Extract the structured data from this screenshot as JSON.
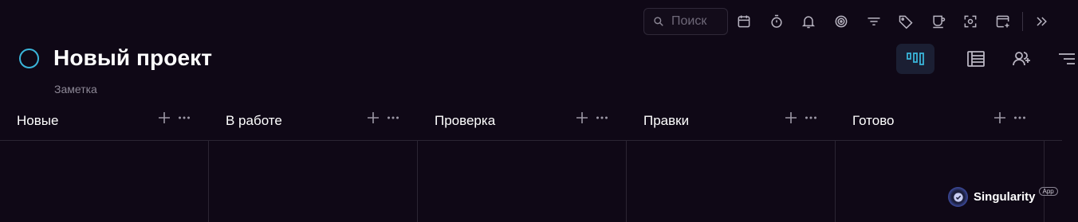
{
  "toolbar": {
    "search_placeholder": "Поиск",
    "icons": [
      "calendar-icon",
      "timer-icon",
      "bell-icon",
      "target-icon",
      "filter-icon",
      "tag-icon",
      "cup-icon",
      "scan-icon",
      "add-window-icon",
      "chevrons-right-icon"
    ]
  },
  "project": {
    "title": "Новый проект",
    "subtitle": "Заметка",
    "status_color": "#3ab4d9"
  },
  "view_switch": {
    "active": "board",
    "icons": [
      "board-view-icon",
      "list-view-icon",
      "add-user-icon",
      "sort-icon"
    ]
  },
  "columns": [
    {
      "title": "Новые"
    },
    {
      "title": "В работе"
    },
    {
      "title": "Проверка"
    },
    {
      "title": "Правки"
    },
    {
      "title": "Готово"
    }
  ],
  "brand": {
    "name": "Singularity",
    "badge": "App"
  },
  "colors": {
    "background": "#0f0816",
    "accent": "#3ab4d9"
  }
}
